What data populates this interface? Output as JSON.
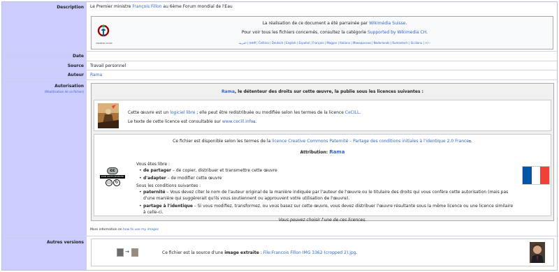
{
  "labels": {
    "description": "Description",
    "date": "Date",
    "source": "Source",
    "author": "Auteur",
    "authorization": "Autorisation",
    "reuse": "(Réutilisation de ce fichier)",
    "other_versions": "Autres versions"
  },
  "description": {
    "pre": "Le Premier ministre ",
    "link": "François Fillon",
    "post": " au 6ème Forum mondial de l'Eau"
  },
  "wikimedia_box": {
    "logo_text": "WIKIMEDIA SUISSE",
    "line1_pre": "La réalisation de ce document a été parrainée par ",
    "line1_link": "Wikimédia Suisse",
    "line1_post": ".",
    "line2_pre": "Pour voir tous les fichiers concernés, consultez la catégorie ",
    "line2_link": "Supported by Wikimedia CH",
    "line2_post": ".",
    "languages": "العربية | फ़ारसी | Čeština | Deutsch | English | Español | Français | Magyar | Italiano | Македонски | Nederlands | Rumantsch | Sicilianu | +/−"
  },
  "date_value": "",
  "source_value": "Travail personnel",
  "author_value": "Rama",
  "license": {
    "header_link": "Rama",
    "header_text": ", le détenteur des droits sur cette œuvre, la publie sous les licences suivantes :",
    "cecill_line1_pre": "Cette œuvre est un ",
    "cecill_line1_link": "logiciel libre",
    "cecill_line1_mid": " ; elle peut être redistribuée ou modifiée selon les termes de la licence ",
    "cecill_line1_link2": "CeCILL",
    "cecill_line1_post": ".",
    "cecill_line2_pre": "Le texte de cette licence est consultable sur ",
    "cecill_line2_link": "www.cecill.info",
    "cecill_line2_post": ".",
    "cc_line_pre": "Ce fichier est disponible selon les termes de la ",
    "cc_line_link": "licence Creative Commons Paternité – Partage des conditions initiales à l'identique 2.0 France",
    "cc_line_post": ".",
    "attribution_label": "Attribution: ",
    "attribution_name": "Rama",
    "free_to": "Vous êtes libre :",
    "share_term": "de partager",
    "share_desc": " – de copier, distribuer et transmettre cette œuvre",
    "adapt_term": "d'adapter",
    "adapt_desc": " – de modifier cette œuvre",
    "conditions": "Sous les conditions suivantes :",
    "attr_term": "paternité",
    "attr_desc": " – Vous devez citer le nom de l'auteur original de la manière indiquée par l'auteur de l'œuvre ou le titulaire des droits qui vous confère cette autorisation (mais pas d'une manière qui suggérerait qu'ils vous soutiennent ou approuvent votre utilisation de l'œuvre).",
    "sa_term": "partage à l'identique",
    "sa_desc": " – Si vous modifiez, transformez, ou vous basez sur cette œuvre, vous devez distribuer l'œuvre résultante sous la même licence ou une licence similaire à celle-ci.",
    "choose": "Vous pouvez choisir l'une de ces licences.",
    "cc_badge_top": "cc",
    "cc_badge_mid": "SOME RIGHTS RESERVED",
    "more_info_pre": "More information on ",
    "more_info_link": "how to use my images"
  },
  "other_versions": {
    "pre": "Ce fichier est la source d'une ",
    "bold": "image extraite",
    "mid": " : ",
    "link": "File:Francois Fillon IMG 3362 (cropped 2).jpg",
    "post": "."
  },
  "colors": {
    "label_bg": "#ccccff",
    "link": "#3366cc",
    "flag_blue": "#0055a4",
    "flag_red": "#ef4135"
  }
}
